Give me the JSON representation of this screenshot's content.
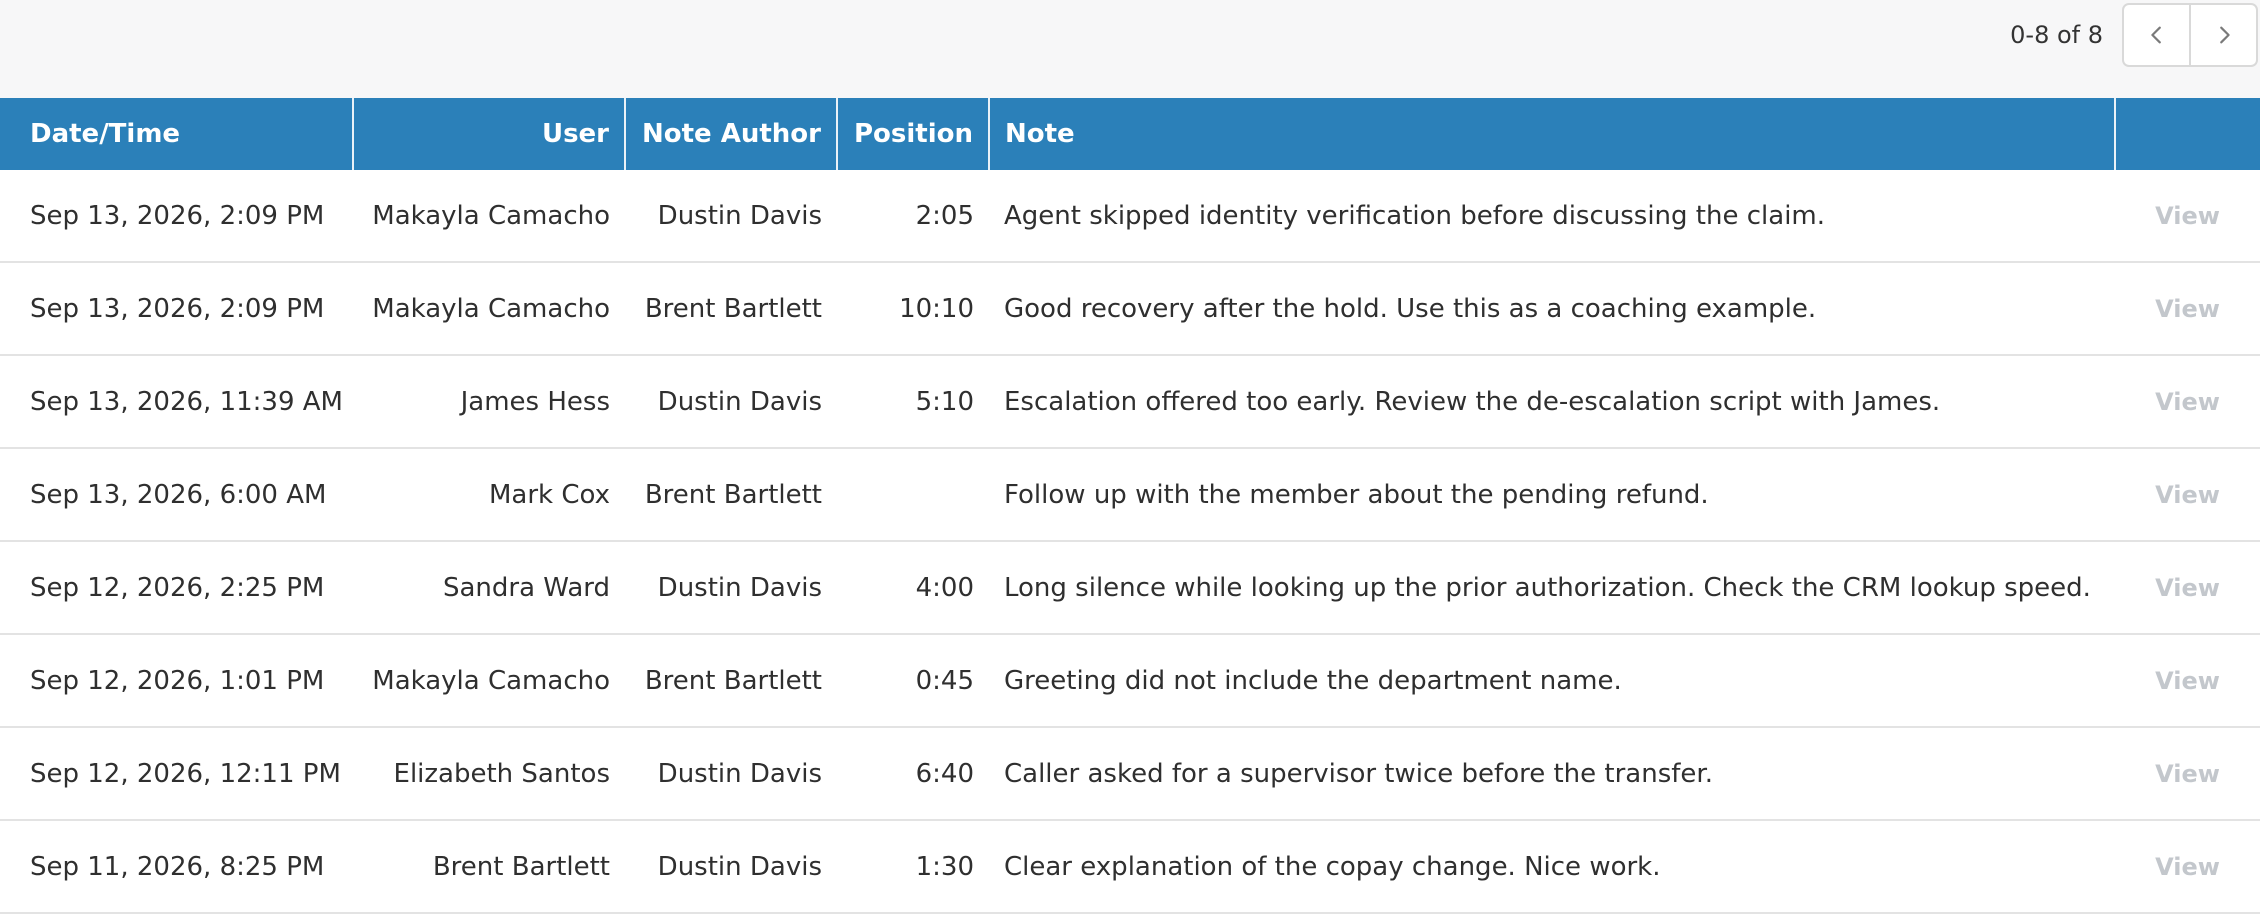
{
  "pagination": {
    "range_label": "0-8 of 8",
    "prev_icon": "chevron-left-icon",
    "next_icon": "chevron-right-icon"
  },
  "table": {
    "columns": [
      "Date/Time",
      "User",
      "Note Author",
      "Position",
      "Note",
      ""
    ],
    "view_label": "View",
    "rows": [
      {
        "datetime": "Sep 13, 2026, 2:09 PM",
        "user": "Makayla Camacho",
        "author": "Dustin Davis",
        "position": "2:05",
        "note": "Agent skipped identity verification before discussing the claim."
      },
      {
        "datetime": "Sep 13, 2026, 2:09 PM",
        "user": "Makayla Camacho",
        "author": "Brent Bartlett",
        "position": "10:10",
        "note": "Good recovery after the hold. Use this as a coaching example."
      },
      {
        "datetime": "Sep 13, 2026, 11:39 AM",
        "user": "James Hess",
        "author": "Dustin Davis",
        "position": "5:10",
        "note": "Escalation offered too early. Review the de-escalation script with James."
      },
      {
        "datetime": "Sep 13, 2026, 6:00 AM",
        "user": "Mark Cox",
        "author": "Brent Bartlett",
        "position": "",
        "note": "Follow up with the member about the pending refund."
      },
      {
        "datetime": "Sep 12, 2026, 2:25 PM",
        "user": "Sandra Ward",
        "author": "Dustin Davis",
        "position": "4:00",
        "note": "Long silence while looking up the prior authorization. Check the CRM lookup speed."
      },
      {
        "datetime": "Sep 12, 2026, 1:01 PM",
        "user": "Makayla Camacho",
        "author": "Brent Bartlett",
        "position": "0:45",
        "note": "Greeting did not include the department name."
      },
      {
        "datetime": "Sep 12, 2026, 12:11 PM",
        "user": "Elizabeth Santos",
        "author": "Dustin Davis",
        "position": "6:40",
        "note": "Caller asked for a supervisor twice before the transfer."
      },
      {
        "datetime": "Sep 11, 2026, 8:25 PM",
        "user": "Brent Bartlett",
        "author": "Dustin Davis",
        "position": "1:30",
        "note": "Clear explanation of the copay change. Nice work."
      }
    ]
  },
  "colors": {
    "header_bg": "#2b80b9",
    "header_text": "#ffffff",
    "topbar_bg": "#f7f7f8",
    "view_link": "#c3c7cc"
  }
}
